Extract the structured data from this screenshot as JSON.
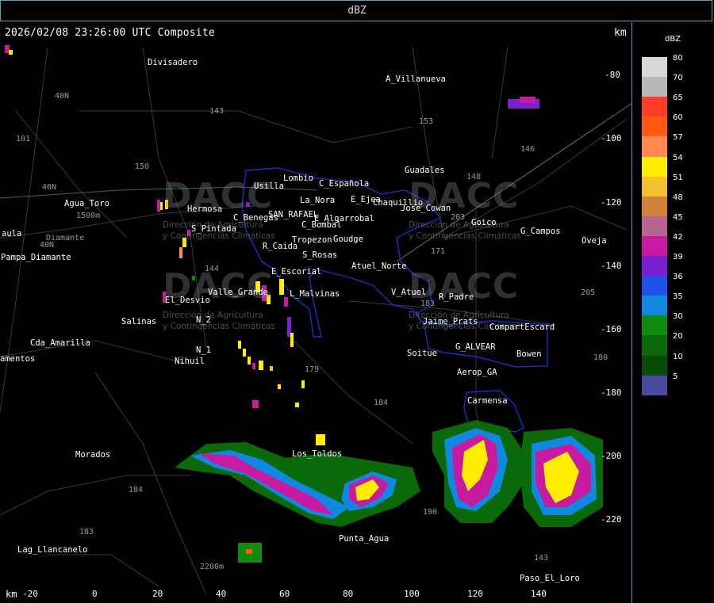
{
  "header": {
    "title": "dBZ"
  },
  "map": {
    "timestamp": "2026/02/08 23:26:00 UTC Composite",
    "unit_top": "km",
    "unit_bottom": "km",
    "y_ticks": [
      "-80",
      "-100",
      "-120",
      "-140",
      "-160",
      "-180",
      "-200",
      "-220"
    ],
    "x_ticks": [
      "-20",
      "0",
      "20",
      "40",
      "60",
      "80",
      "100",
      "120",
      "140"
    ],
    "places": [
      "Divisadero",
      "A_Villanueva",
      "Guadales",
      "Usilla",
      "Lombio",
      "La_Nora",
      "C_Española",
      "E_Ejea",
      "Chaquillio",
      "Jose_Cowan",
      "Goico",
      "G_Campos",
      "Oveja",
      "Agua_Toro",
      "S_Pintada",
      "C_Benegas",
      "SAN_RAFAEL",
      "E_Algarrobal",
      "C_Bombal",
      "Tropezon",
      "Goudge",
      "R_Caida",
      "S_Rosas",
      "Atuel_Norte",
      "E_Escorial",
      "V_Atuel",
      "R_Padre",
      "Valle_Grande",
      "L_Malvinas",
      "El_Desvio",
      "Salinas",
      "N_2",
      "Jaime_Prats",
      "CompartEscard",
      "G_ALVEAR",
      "Bowen",
      "Soitue",
      "N_1",
      "Nihuil",
      "Cda_Amarilla",
      "Aerop_GA",
      "Carmensa",
      "Morados",
      "Los_Toldos",
      "Punta_Agua",
      "Lag_Llancanelo",
      "Paso_El_Loro",
      "Pampa_Diamante",
      "aula",
      "amentos",
      "Diamante",
      "Hermosa"
    ],
    "route_numbers": [
      "143",
      "40N",
      "101",
      "150",
      "40N",
      "40N",
      "153",
      "146",
      "148",
      "203",
      "171",
      "144",
      "183",
      "184",
      "190",
      "180",
      "179",
      "205",
      "184",
      "183",
      "143",
      "1500m",
      "2200m"
    ],
    "watermark": {
      "brand": "DACC",
      "line1": "Dirección de Agricultura",
      "line2": "y Contingencias Climáticas"
    }
  },
  "legend": {
    "title": "dBZ",
    "entries": [
      {
        "label": "80",
        "color": "#d8d8d8"
      },
      {
        "label": "70",
        "color": "#b8b8b8"
      },
      {
        "label": "65",
        "color": "#ff3b2a"
      },
      {
        "label": "60",
        "color": "#ff5a10"
      },
      {
        "label": "57",
        "color": "#ff8a50"
      },
      {
        "label": "54",
        "color": "#ffee00"
      },
      {
        "label": "51",
        "color": "#f5c030"
      },
      {
        "label": "48",
        "color": "#d0843a"
      },
      {
        "label": "45",
        "color": "#b86690"
      },
      {
        "label": "42",
        "color": "#c81aa0"
      },
      {
        "label": "39",
        "color": "#7a20d0"
      },
      {
        "label": "36",
        "color": "#2050e8"
      },
      {
        "label": "35",
        "color": "#1088e0"
      },
      {
        "label": "30",
        "color": "#108a10"
      },
      {
        "label": "20",
        "color": "#0a6a0a"
      },
      {
        "label": "10",
        "color": "#0a4a0a"
      },
      {
        "label": "5",
        "color": "#4a4aa0"
      }
    ]
  }
}
